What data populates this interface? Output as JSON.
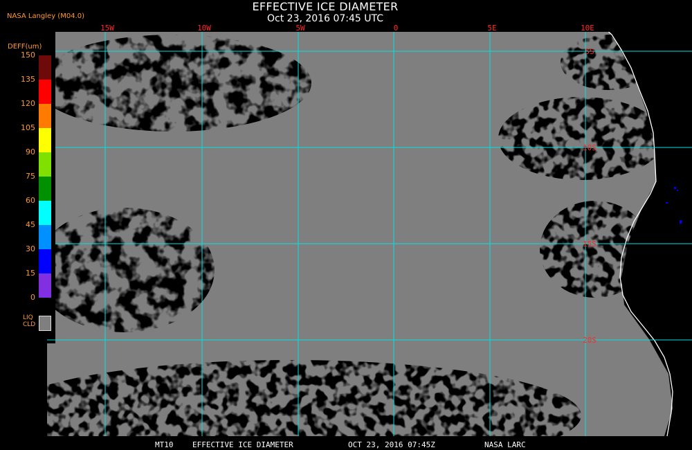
{
  "header": {
    "title": "EFFECTIVE ICE DIAMETER",
    "subtitle": "Oct 23, 2016 07:45 UTC",
    "producer": "NASA Langley (M04.0)"
  },
  "legend": {
    "title": "DEFF(um)",
    "ticks": [
      "150",
      "135",
      "120",
      "105",
      "90",
      "75",
      "60",
      "45",
      "30",
      "15",
      "0"
    ],
    "colors": [
      "#6e0a0a",
      "#ff0000",
      "#ff7a00",
      "#ffff00",
      "#80e000",
      "#009000",
      "#00ffff",
      "#0090ff",
      "#0000ff",
      "#8030e0"
    ],
    "liquid_cloud_label": [
      "LIQ",
      "CLD"
    ],
    "liquid_cloud_color": "#7f7f7f"
  },
  "map": {
    "longitude_labels": [
      "15W",
      "10W",
      "5W",
      "0",
      "5E",
      "10E"
    ],
    "latitude_labels": [
      "5S",
      "10S",
      "15S",
      "20S"
    ],
    "grid_color": "#00e0e0",
    "label_color": "#ff2a2a",
    "cloud_color": "#7f7f7f",
    "clear_sky_color": "#000000",
    "coastline_color": "#ffffff"
  },
  "footer": {
    "id": "MT10",
    "product": "EFFECTIVE ICE DIAMETER",
    "datetime": "OCT 23, 2016 07:45Z",
    "source": "NASA LARC"
  }
}
